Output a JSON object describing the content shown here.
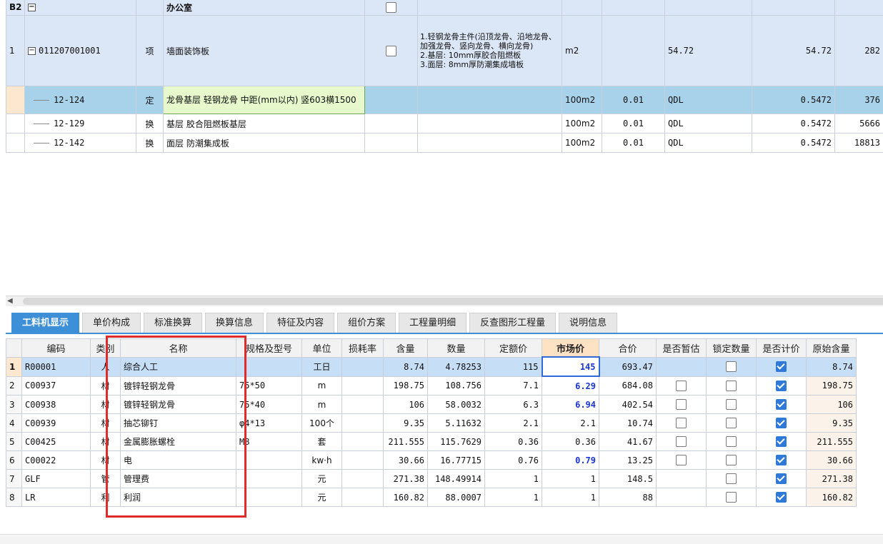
{
  "top_grid": {
    "group_row": {
      "code": "B2",
      "name": "办公室"
    },
    "item_row": {
      "rownum": "1",
      "code": "011207001001",
      "type": "项",
      "name": "墙面装饰板",
      "desc": "1.轻钢龙骨主件(沿顶龙骨、沿地龙骨、加强龙骨、竖向龙骨、横向龙骨)\n2.基层: 10mm厚胶合阻燃板\n3.面层: 8mm厚防潮集成墙板",
      "unit": "m2",
      "expr": "54.72",
      "qty": "54.72",
      "price": "282"
    },
    "sub_rows": [
      {
        "code": "12-124",
        "type": "定",
        "name": "龙骨基层 轻钢龙骨 中距(mm以内) 竖603横1500",
        "unit": "100m2",
        "coef": "0.01",
        "expr": "QDL",
        "qty": "0.5472",
        "price": "376"
      },
      {
        "code": "12-129",
        "type": "换",
        "name": "基层 胶合阻燃板基层",
        "unit": "100m2",
        "coef": "0.01",
        "expr": "QDL",
        "qty": "0.5472",
        "price": "5666"
      },
      {
        "code": "12-142",
        "type": "换",
        "name": "面层 防潮集成板",
        "unit": "100m2",
        "coef": "0.01",
        "expr": "QDL",
        "qty": "0.5472",
        "price": "18813"
      }
    ]
  },
  "tabs": [
    "工料机显示",
    "单价构成",
    "标准换算",
    "换算信息",
    "特征及内容",
    "组价方案",
    "工程量明细",
    "反查图形工程量",
    "说明信息"
  ],
  "bottom_grid": {
    "headers": [
      "",
      "编码",
      "类别",
      "名称",
      "规格及型号",
      "单位",
      "损耗率",
      "含量",
      "数量",
      "定额价",
      "市场价",
      "合价",
      "是否暂估",
      "锁定数量",
      "是否计价",
      "原始含量"
    ],
    "rows": [
      {
        "n": "1",
        "code": "R00001",
        "cat": "人",
        "name": "综合人工",
        "spec": "",
        "unit": "工日",
        "loss": "",
        "content": "8.74",
        "qty": "4.78253",
        "quota": "115",
        "market": "145",
        "total": "693.47",
        "orig": "8.74"
      },
      {
        "n": "2",
        "code": "C00937",
        "cat": "材",
        "name": "镀锌轻钢龙骨",
        "spec": "75*50",
        "unit": "m",
        "loss": "",
        "content": "198.75",
        "qty": "108.756",
        "quota": "7.1",
        "market": "6.29",
        "total": "684.08",
        "orig": "198.75"
      },
      {
        "n": "3",
        "code": "C00938",
        "cat": "材",
        "name": "镀锌轻钢龙骨",
        "spec": "75*40",
        "unit": "m",
        "loss": "",
        "content": "106",
        "qty": "58.0032",
        "quota": "6.3",
        "market": "6.94",
        "total": "402.54",
        "orig": "106"
      },
      {
        "n": "4",
        "code": "C00939",
        "cat": "材",
        "name": "抽芯铆钉",
        "spec": "φ4*13",
        "unit": "100个",
        "loss": "",
        "content": "9.35",
        "qty": "5.11632",
        "quota": "2.1",
        "market": "2.1",
        "total": "10.74",
        "orig": "9.35"
      },
      {
        "n": "5",
        "code": "C00425",
        "cat": "材",
        "name": "金属膨胀螺栓",
        "spec": "M8",
        "unit": "套",
        "loss": "",
        "content": "211.555",
        "qty": "115.7629",
        "quota": "0.36",
        "market": "0.36",
        "total": "41.67",
        "orig": "211.555"
      },
      {
        "n": "6",
        "code": "C00022",
        "cat": "材",
        "name": "电",
        "spec": "",
        "unit": "kw·h",
        "loss": "",
        "content": "30.66",
        "qty": "16.77715",
        "quota": "0.76",
        "market": "0.79",
        "total": "13.25",
        "orig": "30.66"
      },
      {
        "n": "7",
        "code": "GLF",
        "cat": "管",
        "name": "管理费",
        "spec": "",
        "unit": "元",
        "loss": "",
        "content": "271.38",
        "qty": "148.49914",
        "quota": "1",
        "market": "1",
        "total": "148.5",
        "orig": "271.38"
      },
      {
        "n": "8",
        "code": "LR",
        "cat": "利",
        "name": "利润",
        "spec": "",
        "unit": "元",
        "loss": "",
        "content": "160.82",
        "qty": "88.0007",
        "quota": "1",
        "market": "1",
        "total": "88",
        "orig": "160.82"
      }
    ]
  },
  "colors": {
    "accent": "#3d8fd8",
    "highlight_box": "#e12a2a",
    "market_price_text": "#1a35d6"
  }
}
